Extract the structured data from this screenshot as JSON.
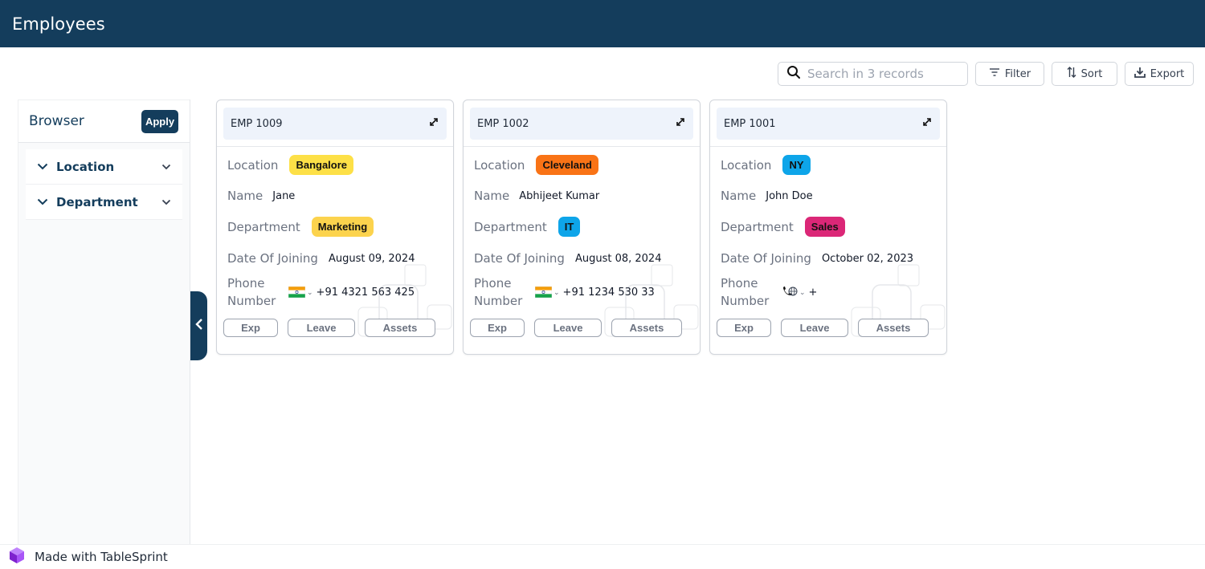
{
  "header": {
    "title": "Employees"
  },
  "toolbar": {
    "search_placeholder": "Search in 3 records",
    "filter_label": "Filter",
    "sort_label": "Sort",
    "export_label": "Export"
  },
  "browser": {
    "title": "Browser",
    "apply_label": "Apply",
    "facets": [
      {
        "label": "Location"
      },
      {
        "label": "Department"
      }
    ]
  },
  "field_labels": {
    "location": "Location",
    "name": "Name",
    "department": "Department",
    "date_of_joining": "Date Of Joining",
    "phone_line1": "Phone",
    "phone_line2": "Number"
  },
  "action_labels": {
    "exp": "Exp",
    "leave": "Leave",
    "assets": "Assets"
  },
  "cards": [
    {
      "id": "EMP 1009",
      "location": "Bangalore",
      "location_color": "#fde047",
      "name": "Jane",
      "department": "Marketing",
      "department_color": "#fcd34d",
      "date_of_joining": "August 09, 2024",
      "phone_flag": "india-flag-icon",
      "phone": "+91 4321 563 425"
    },
    {
      "id": "EMP 1002",
      "location": "Cleveland",
      "location_color": "#f97316",
      "name": "Abhijeet Kumar",
      "department": "IT",
      "department_color": "#0ea5e9",
      "date_of_joining": "August 08, 2024",
      "phone_flag": "india-flag-icon",
      "phone": "+91 1234 530 33"
    },
    {
      "id": "EMP 1001",
      "location": "NY",
      "location_color": "#0ea5e9",
      "name": "John Doe",
      "department": "Sales",
      "department_color": "#db2777",
      "date_of_joining": "October 02, 2023",
      "phone_flag": "globe-phone-icon",
      "phone": "+"
    }
  ],
  "footer": {
    "text": "Made with TableSprint"
  },
  "colors": {
    "brand": "#143d5c",
    "card_head_bg": "#eef3fb"
  }
}
